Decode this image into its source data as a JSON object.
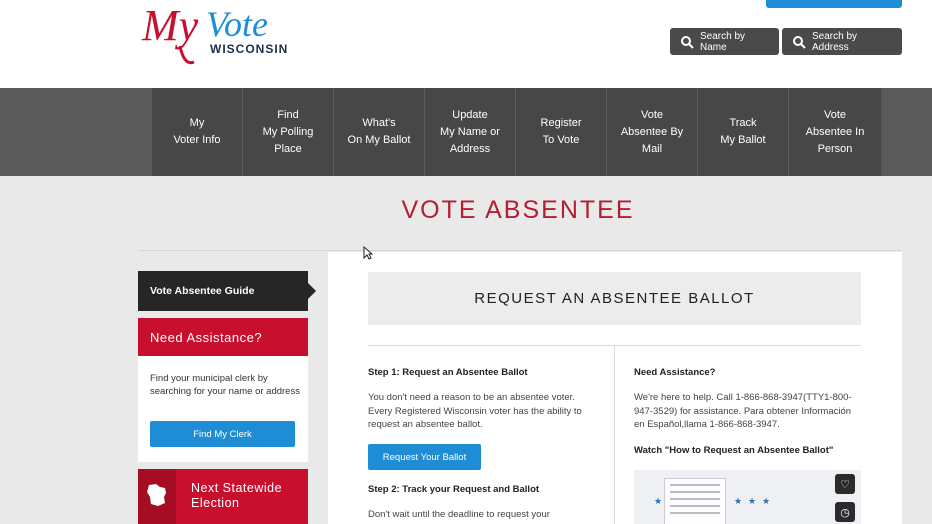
{
  "header": {
    "logo_my": "My",
    "logo_vote": "Vote",
    "logo_state": "WISCONSIN",
    "search_name": "Search by Name",
    "search_address": "Search by Address"
  },
  "nav": [
    {
      "label": "My\nVoter Info"
    },
    {
      "label": "Find\nMy Polling\nPlace"
    },
    {
      "label": "What's\nOn My Ballot"
    },
    {
      "label": "Update\nMy Name or\nAddress"
    },
    {
      "label": "Register\nTo Vote"
    },
    {
      "label": "Vote\nAbsentee By\nMail"
    },
    {
      "label": "Track\nMy Ballot"
    },
    {
      "label": "Vote\nAbsentee In\nPerson"
    }
  ],
  "page": {
    "title": "VOTE ABSENTEE"
  },
  "sidebar": {
    "guide": "Vote Absentee Guide",
    "assist_title": "Need Assistance?",
    "assist_text": "Find your municipal clerk by searching for your name or address",
    "clerk_button": "Find My Clerk",
    "election": "Next Statewide\nElection"
  },
  "main": {
    "heading": "REQUEST AN ABSENTEE BALLOT",
    "step1_title": "Step 1: Request an Absentee Ballot",
    "step1_text": "You don't need a reason to be an absentee voter. Every Registered Wisconsin voter has the ability to request an absentee ballot.",
    "request_button": "Request Your Ballot",
    "step2_title": "Step 2: Track your Request and Ballot",
    "step2_text": "Don't wait until the deadline to request your",
    "help_title": "Need Assistance?",
    "help_text": "We're here to help. Call 1-866-868-3947(TTY1-800-947-3529) for assistance. Para obtener Información en Español,llama 1-866-868-3947.",
    "video_title": "Watch \"How to Request an Absentee Ballot\""
  },
  "colors": {
    "brand_red": "#c8102e",
    "brand_blue": "#1f8dd6",
    "nav_dark": "#474747"
  }
}
